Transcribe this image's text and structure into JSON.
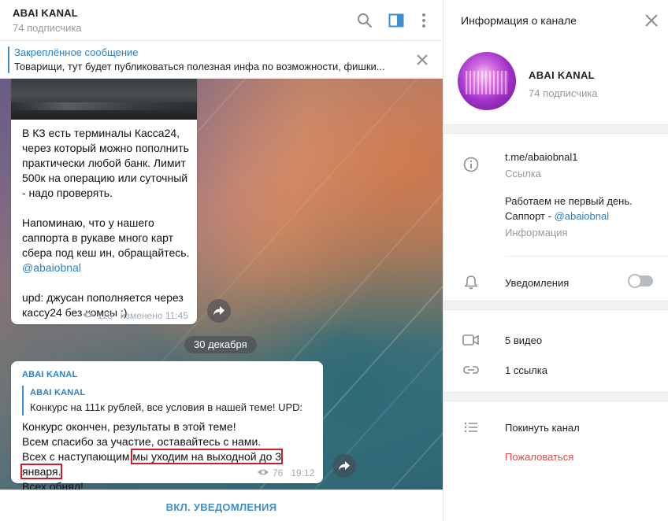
{
  "chat": {
    "title": "ABAI KANAL",
    "subtitle": "74 подписчика",
    "pinned": {
      "title": "Закреплённое сообщение",
      "text": "Товарищи, тут будет публиковаться полезная инфа по возможности, фишки..."
    },
    "message1": {
      "para1": "В КЗ есть терминалы Касса24, через который можно пополнить практически любой банк. Лимит 500к на операцию или суточный - надо проверять.",
      "para2_text": "Напоминаю, что у нашего саппорта в рукаве много карт сбера под кеш ин, обращайтесь.",
      "para2_link": "@abaiobnal",
      "para3": "upd: джусан пополняется через кассу24 без комсы :)",
      "views": "118",
      "edited": "изменено 11:45"
    },
    "date_separator": "30 декабря",
    "message2": {
      "author": "ABAI KANAL",
      "quote_author": "ABAI KANAL",
      "quote_text": "Конкурс на 111к рублей, все условия в нашей теме!  UPD:",
      "line1": "Конкурс окончен, результаты в этой теме!",
      "line2": "Всем спасибо за участие, оставайтесь с нами.",
      "line3_pre": "Всех с наступающим,",
      "line3_highlight": "мы уходим на выходной до 3 января.",
      "line4": "Всех обнял!",
      "views": "76",
      "time": "19:12"
    },
    "footer_button": "ВКЛ. УВЕДОМЛЕНИЯ"
  },
  "panel": {
    "title": "Информация о канале",
    "channel_name": "ABAI KANAL",
    "subscribers": "74 подписчика",
    "link": "t.me/abaiobnal1",
    "link_label": "Ссылка",
    "info_line1": "Работаем не первый день.",
    "info_line2_text": "Саппорт - ",
    "info_line2_link": "@abaiobnal",
    "info_label": "Информация",
    "notifications_label": "Уведомления",
    "notifications_on": false,
    "videos": "5 видео",
    "links": "1 ссылка",
    "leave": "Покинуть канал",
    "report": "Пожаловаться"
  },
  "colors": {
    "accent": "#3d8fd1",
    "link": "#2b7fc3",
    "highlight_box": "#cc1e2c",
    "danger": "#e04a4a"
  },
  "icons": [
    "search-icon",
    "sidebar-toggle-icon",
    "more-vertical-icon",
    "close-icon",
    "forward-icon",
    "eye-icon",
    "info-icon",
    "bell-icon",
    "video-icon",
    "link-icon",
    "list-icon"
  ]
}
